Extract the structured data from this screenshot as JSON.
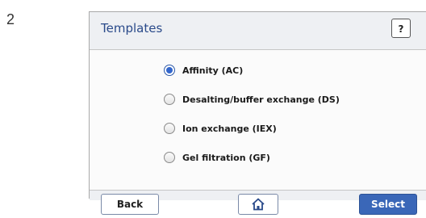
{
  "step_number": "2",
  "header": {
    "title": "Templates",
    "help_label": "?"
  },
  "options": [
    {
      "label": "Affinity (AC)",
      "checked": true
    },
    {
      "label": "Desalting/buffer exchange (DS)",
      "checked": false
    },
    {
      "label": "Ion exchange (IEX)",
      "checked": false
    },
    {
      "label": "Gel filtration (GF)",
      "checked": false
    }
  ],
  "footer": {
    "back_label": "Back",
    "home_icon": "home-icon",
    "select_label": "Select"
  }
}
